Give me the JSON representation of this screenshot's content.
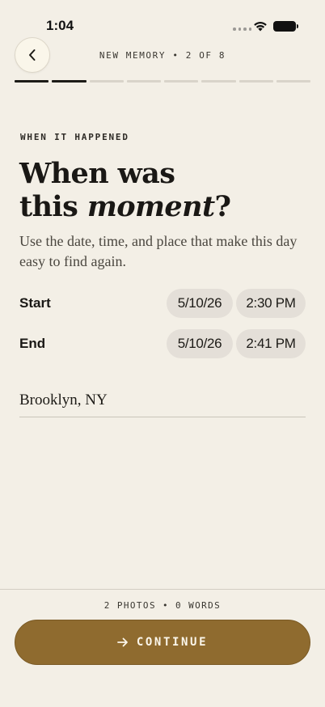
{
  "status_bar": {
    "time": "1:04"
  },
  "header": {
    "step_label": "NEW MEMORY • 2 OF 8",
    "progress_total": 8,
    "progress_done": 2
  },
  "content": {
    "eyebrow": "WHEN IT HAPPENED",
    "title_line1": "When was",
    "title_line2_pre": "this ",
    "title_emphasis": "moment",
    "title_suffix": "?",
    "subtitle": "Use the date, time, and place that make this day easy to find again.",
    "start": {
      "label": "Start",
      "date": "5/10/26",
      "time": "2:30 PM"
    },
    "end": {
      "label": "End",
      "date": "5/10/26",
      "time": "2:41 PM"
    },
    "location": {
      "value": "Brooklyn, NY"
    }
  },
  "footer": {
    "stats": "2 PHOTOS • 0 WORDS",
    "continue_label": "CONTINUE"
  },
  "colors": {
    "background": "#f3efe6",
    "accent": "#8f6b2f",
    "pill": "#e4dfd8"
  }
}
